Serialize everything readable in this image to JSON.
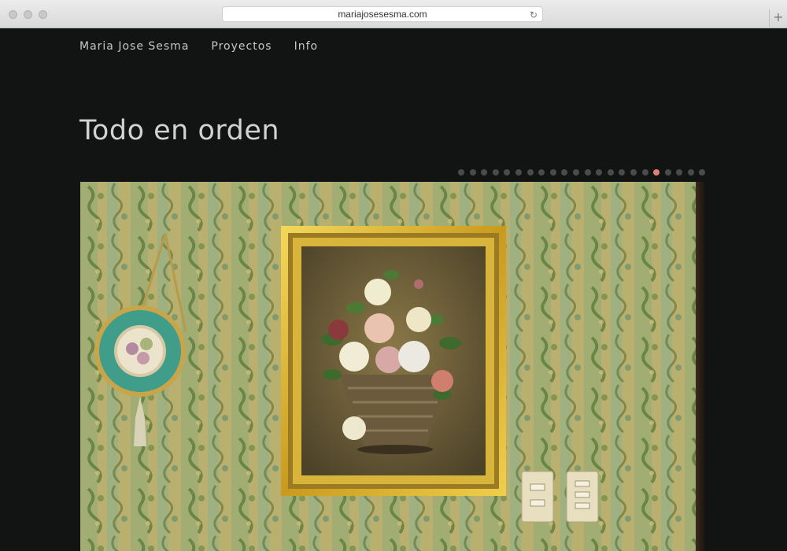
{
  "browser": {
    "url": "mariajosesesma.com",
    "reload_icon": "reload-icon",
    "new_tab_icon": "plus-icon"
  },
  "nav": {
    "items": [
      "Maria Jose Sesma",
      "Proyectos",
      "Info"
    ]
  },
  "project": {
    "title": "Todo en orden"
  },
  "gallery": {
    "dot_count": 22,
    "active_index": 17,
    "active_color": "#e0816f",
    "inactive_color": "#4a4c4b"
  },
  "colors": {
    "background": "#121413",
    "nav_text": "#c6c6c6",
    "title_text": "#d2d2d2"
  }
}
